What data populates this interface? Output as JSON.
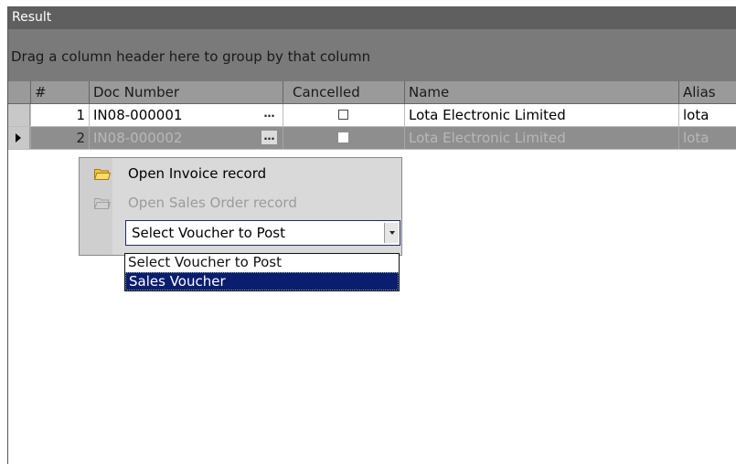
{
  "panel": {
    "title": "Result"
  },
  "group_panel": {
    "hint": "Drag a column header here to group by that column"
  },
  "grid": {
    "columns": [
      "#",
      "Doc Number",
      "Cancelled",
      "Name",
      "Alias"
    ],
    "rows": [
      {
        "num": "1",
        "doc_number": "IN08-000001",
        "ellipsis": "…",
        "cancelled": false,
        "name": "Lota Electronic Limited",
        "alias": "lota",
        "selected": false
      },
      {
        "num": "2",
        "doc_number": "IN08-000002",
        "ellipsis": "…",
        "cancelled": false,
        "name": "Lota Electronic Limited",
        "alias": "lota",
        "selected": true
      }
    ]
  },
  "context_menu": {
    "items": [
      {
        "label": "Open Invoice record",
        "icon": "folder-open-icon",
        "enabled": true
      },
      {
        "label": "Open Sales Order record",
        "icon": "folder-icon",
        "enabled": false
      }
    ],
    "voucher_select": {
      "selected": "Select Voucher to Post",
      "options": [
        "Select Voucher to Post",
        "Sales Voucher"
      ],
      "highlighted": "Sales Voucher"
    }
  },
  "colors": {
    "title_bar": "#5f5f5f",
    "group_panel": "#7a7a7a",
    "header": "#9a9a9a",
    "selected_row": "#8e8e8e",
    "highlight": "#0a1d6e"
  }
}
